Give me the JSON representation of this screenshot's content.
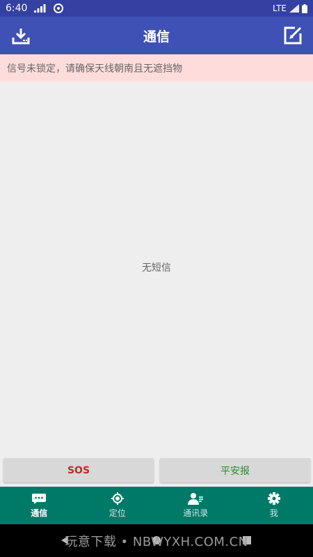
{
  "status_bar": {
    "time": "6:40",
    "network": "LTE"
  },
  "app_bar": {
    "title": "通信",
    "left_icon": "download-icon",
    "right_icon": "compose-icon"
  },
  "banner": {
    "text": "信号未锁定，请确保天线朝南且无遮挡物"
  },
  "content": {
    "empty_text": "无短信"
  },
  "actions": {
    "sos_label": "SOS",
    "safe_label": "平安报"
  },
  "bottom_nav": {
    "items": [
      {
        "label": "通信",
        "icon": "chat-icon",
        "active": true
      },
      {
        "label": "定位",
        "icon": "locate-icon",
        "active": false
      },
      {
        "label": "通讯录",
        "icon": "contacts-icon",
        "active": false
      },
      {
        "label": "我",
        "icon": "gear-icon",
        "active": false
      }
    ]
  },
  "watermark": {
    "text": "玩意下载 • NBWYXH.COM.CN"
  },
  "colors": {
    "primary": "#3f51b5",
    "status": "#3441a3",
    "nav": "#007a68",
    "banner": "#ffdcdc",
    "sos": "#c62828",
    "safe": "#2e8b2e"
  }
}
